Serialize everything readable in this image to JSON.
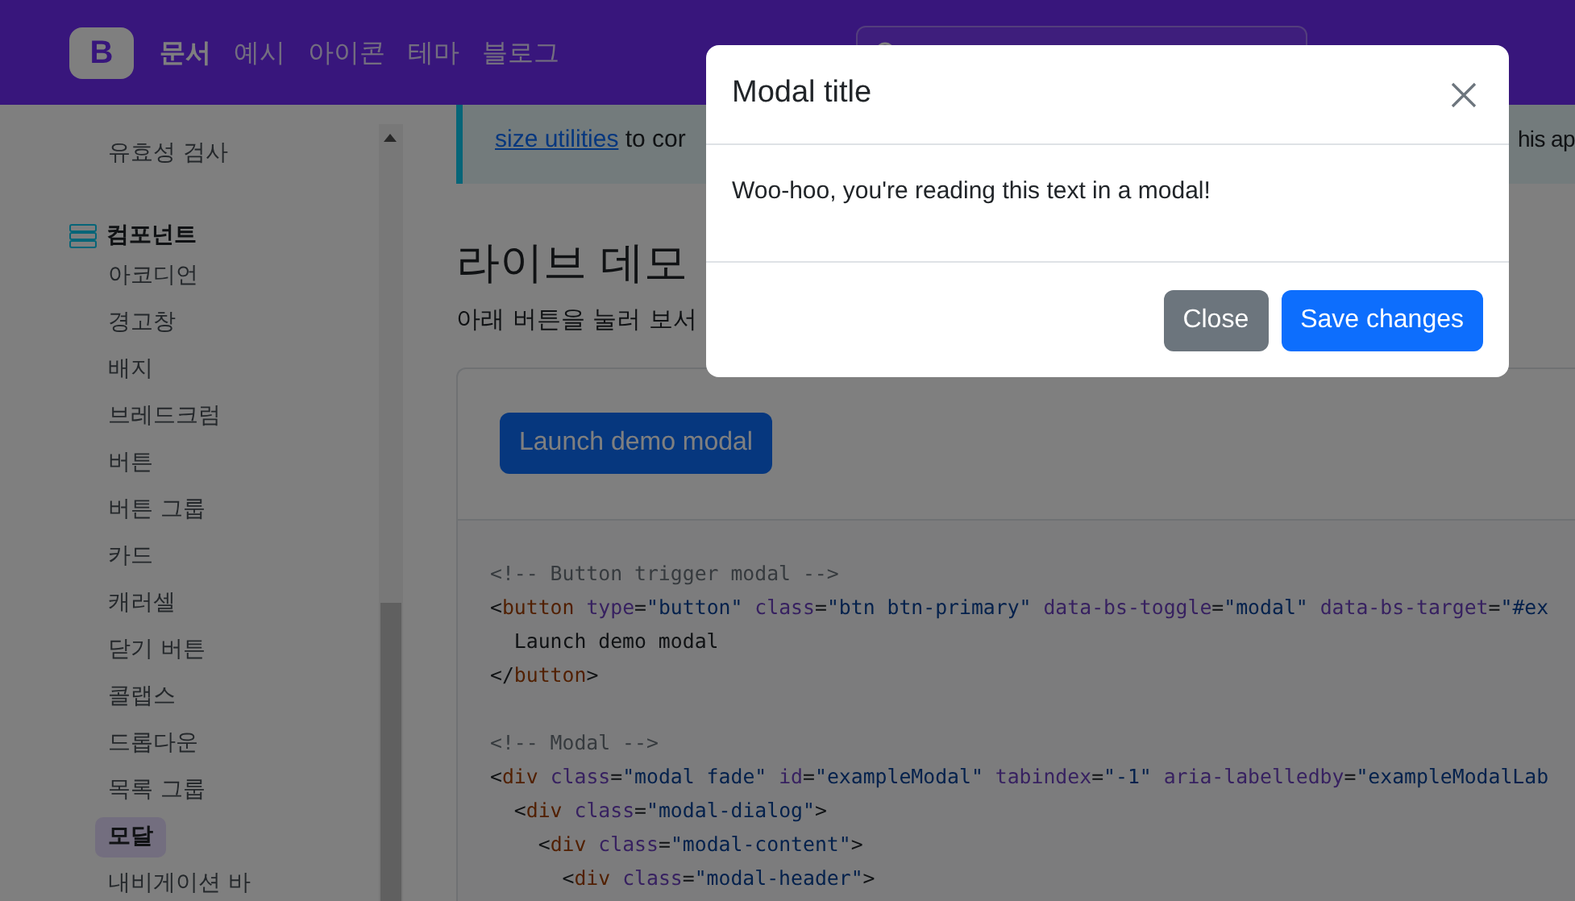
{
  "navbar": {
    "logo": "B",
    "links": [
      {
        "label": "문서",
        "selected": true
      },
      {
        "label": "예시",
        "selected": false
      },
      {
        "label": "아이콘",
        "selected": false
      },
      {
        "label": "테마",
        "selected": false
      },
      {
        "label": "블로그",
        "selected": false
      }
    ]
  },
  "sidebar": {
    "top_item": "유효성 검사",
    "section": "컴포넌트",
    "items": [
      {
        "label": "아코디언",
        "selected": false
      },
      {
        "label": "경고창",
        "selected": false
      },
      {
        "label": "배지",
        "selected": false
      },
      {
        "label": "브레드크럼",
        "selected": false
      },
      {
        "label": "버튼",
        "selected": false
      },
      {
        "label": "버튼 그룹",
        "selected": false
      },
      {
        "label": "카드",
        "selected": false
      },
      {
        "label": "캐러셀",
        "selected": false
      },
      {
        "label": "닫기 버튼",
        "selected": false
      },
      {
        "label": "콜랩스",
        "selected": false
      },
      {
        "label": "드롭다운",
        "selected": false
      },
      {
        "label": "목록 그룹",
        "selected": false
      },
      {
        "label": "모달",
        "selected": true
      },
      {
        "label": "내비게이션 바",
        "selected": false
      }
    ]
  },
  "callout": {
    "link": "size utilities",
    "text_left": " to cor",
    "text_right": "his ap"
  },
  "section": {
    "heading": "라이브 데모",
    "intro": "아래 버튼을 눌러 보서"
  },
  "example": {
    "button": "Launch demo modal"
  },
  "code": [
    [
      {
        "kind": "comment",
        "text": "<!-- Button trigger modal -->"
      }
    ],
    [
      {
        "kind": "punct",
        "text": "<"
      },
      {
        "kind": "tag",
        "text": "button"
      },
      {
        "kind": "attr",
        "text": " type"
      },
      {
        "kind": "punct",
        "text": "="
      },
      {
        "kind": "str",
        "text": "\"button\""
      },
      {
        "kind": "attr",
        "text": " class"
      },
      {
        "kind": "punct",
        "text": "="
      },
      {
        "kind": "str",
        "text": "\"btn btn-primary\""
      },
      {
        "kind": "attr",
        "text": " data-bs-toggle"
      },
      {
        "kind": "punct",
        "text": "="
      },
      {
        "kind": "str",
        "text": "\"modal\""
      },
      {
        "kind": "attr",
        "text": " data-bs-target"
      },
      {
        "kind": "punct",
        "text": "="
      },
      {
        "kind": "str",
        "text": "\"#ex"
      }
    ],
    [
      {
        "kind": "text",
        "text": "  Launch demo modal"
      }
    ],
    [
      {
        "kind": "punct",
        "text": "</"
      },
      {
        "kind": "tag",
        "text": "button"
      },
      {
        "kind": "punct",
        "text": ">"
      }
    ],
    [
      {
        "kind": "blank"
      }
    ],
    [
      {
        "kind": "comment",
        "text": "<!-- Modal -->"
      }
    ],
    [
      {
        "kind": "punct",
        "text": "<"
      },
      {
        "kind": "tag",
        "text": "div"
      },
      {
        "kind": "attr",
        "text": " class"
      },
      {
        "kind": "punct",
        "text": "="
      },
      {
        "kind": "str",
        "text": "\"modal fade\""
      },
      {
        "kind": "attr",
        "text": " id"
      },
      {
        "kind": "punct",
        "text": "="
      },
      {
        "kind": "str",
        "text": "\"exampleModal\""
      },
      {
        "kind": "attr",
        "text": " tabindex"
      },
      {
        "kind": "punct",
        "text": "="
      },
      {
        "kind": "str",
        "text": "\"-1\""
      },
      {
        "kind": "attr",
        "text": " aria-labelledby"
      },
      {
        "kind": "punct",
        "text": "="
      },
      {
        "kind": "str",
        "text": "\"exampleModalLab"
      }
    ],
    [
      {
        "kind": "punct",
        "text": "  <"
      },
      {
        "kind": "tag",
        "text": "div"
      },
      {
        "kind": "attr",
        "text": " class"
      },
      {
        "kind": "punct",
        "text": "="
      },
      {
        "kind": "str",
        "text": "\"modal-dialog\""
      },
      {
        "kind": "punct",
        "text": ">"
      }
    ],
    [
      {
        "kind": "punct",
        "text": "    <"
      },
      {
        "kind": "tag",
        "text": "div"
      },
      {
        "kind": "attr",
        "text": " class"
      },
      {
        "kind": "punct",
        "text": "="
      },
      {
        "kind": "str",
        "text": "\"modal-content\""
      },
      {
        "kind": "punct",
        "text": ">"
      }
    ],
    [
      {
        "kind": "punct",
        "text": "      <"
      },
      {
        "kind": "tag",
        "text": "div"
      },
      {
        "kind": "attr",
        "text": " class"
      },
      {
        "kind": "punct",
        "text": "="
      },
      {
        "kind": "str",
        "text": "\"modal-header\""
      },
      {
        "kind": "punct",
        "text": ">"
      }
    ]
  ],
  "modal": {
    "title": "Modal title",
    "body": "Woo-hoo, you're reading this text in a modal!",
    "buttons": [
      {
        "label": "Close",
        "kind": "secondary"
      },
      {
        "label": "Save changes",
        "kind": "primary"
      }
    ]
  }
}
